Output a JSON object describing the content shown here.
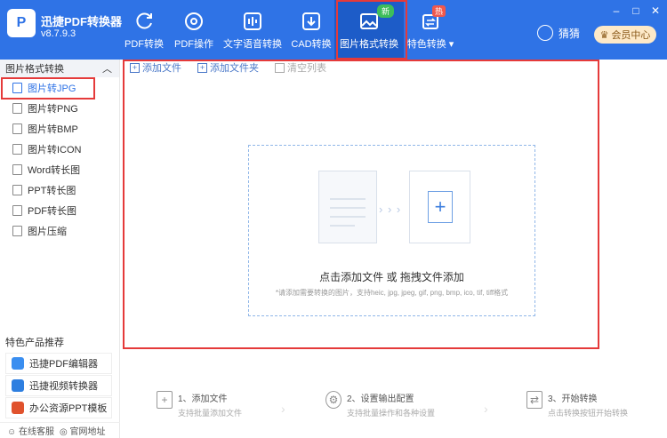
{
  "app": {
    "title": "迅捷PDF转换器",
    "version": "v8.7.9.3",
    "logo_letter": "P"
  },
  "nav": {
    "items": [
      {
        "label": "PDF转换",
        "icon": "refresh-icon"
      },
      {
        "label": "PDF操作",
        "icon": "compass-icon"
      },
      {
        "label": "文字语音转换",
        "icon": "audio-wave-icon"
      },
      {
        "label": "CAD转换",
        "icon": "download-box-icon"
      },
      {
        "label": "图片格式转换",
        "icon": "image-icon",
        "badge": "新"
      },
      {
        "label": "特色转换",
        "icon": "swap-icon",
        "badge": "热"
      }
    ]
  },
  "window": {
    "min": "–",
    "restore": "□",
    "close": "✕"
  },
  "user": {
    "name": "猜猜",
    "vip_label": "会员中心"
  },
  "sidebar": {
    "header": "图片格式转换",
    "items": [
      {
        "label": "图片转JPG"
      },
      {
        "label": "图片转PNG"
      },
      {
        "label": "图片转BMP"
      },
      {
        "label": "图片转ICON"
      },
      {
        "label": "Word转长图"
      },
      {
        "label": "PPT转长图"
      },
      {
        "label": "PDF转长图"
      },
      {
        "label": "图片压缩"
      }
    ],
    "products_title": "特色产品推荐",
    "products": [
      {
        "label": "迅捷PDF编辑器",
        "color": "#3a8ef0"
      },
      {
        "label": "迅捷视频转换器",
        "color": "#2e7fe0"
      },
      {
        "label": "办公资源PPT模板",
        "color": "#e0522d"
      }
    ],
    "footer": {
      "service": "在线客服",
      "website": "官网地址"
    }
  },
  "toolbar": {
    "add_file": "添加文件",
    "add_folder": "添加文件夹",
    "clear": "清空列表"
  },
  "dropzone": {
    "main_text": "点击添加文件 或 拖拽文件添加",
    "hint": "*请添加需要转换的图片，支持heic, jpg, jpeg, gif, png, bmp, ico, tif, tiff格式",
    "arrows": "› › ›",
    "plus": "+"
  },
  "steps": [
    {
      "title": "1、添加文件",
      "desc": "支持批量添加文件"
    },
    {
      "title": "2、设置输出配置",
      "desc": "支持批量操作和各种设置"
    },
    {
      "title": "3、开始转换",
      "desc": "点击转换按钮开始转换"
    }
  ],
  "colors": {
    "header_bg": "#2f73e6",
    "active_nav": "#1d5cc8",
    "highlight": "#e53a3a",
    "accent": "#2f73e6"
  }
}
